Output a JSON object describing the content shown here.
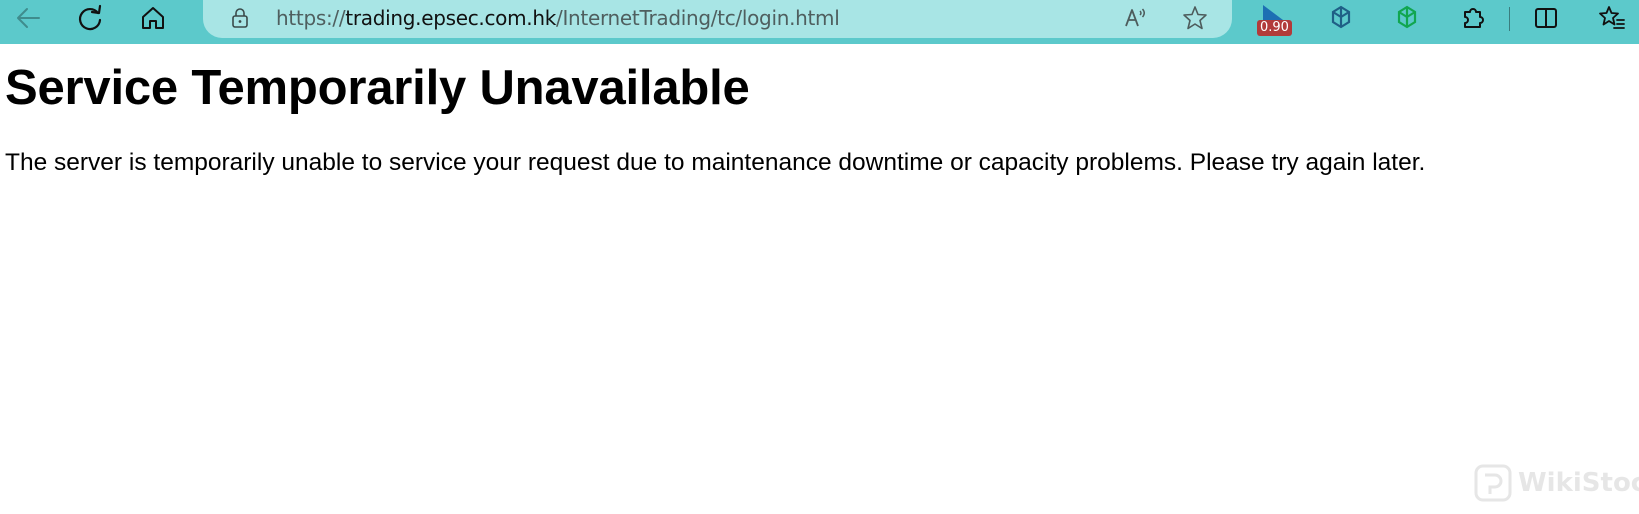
{
  "browser": {
    "url": {
      "scheme": "https://",
      "host": "trading.epsec.com.hk",
      "path": "/InternetTrading/tc/login.html"
    },
    "extension_badge": "0.90",
    "icons": [
      "back-icon",
      "refresh-icon",
      "home-icon",
      "lock-icon",
      "read-aloud-icon",
      "favorite-star-icon",
      "extension-badge-icon",
      "chatgpt-sider-icon",
      "chatgpt-icon",
      "extensions-puzzle-icon",
      "split-screen-icon",
      "favorites-list-icon"
    ],
    "toolbar_color": "#5cc9cb",
    "address_bar_color": "#a8e5e5"
  },
  "page": {
    "heading": "Service Temporarily Unavailable",
    "message": "The server is temporarily unable to service your request due to maintenance downtime or capacity problems. Please try again later."
  },
  "watermark": {
    "logo_text": "WikiStock"
  }
}
